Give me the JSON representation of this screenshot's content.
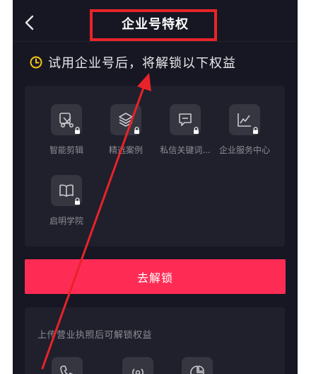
{
  "header": {
    "title": "企业号特权"
  },
  "notice": {
    "text": "试用企业号后，将解锁以下权益"
  },
  "features": [
    {
      "label": "智能剪辑",
      "icon": "scissors-icon"
    },
    {
      "label": "精选案例",
      "icon": "layers-icon"
    },
    {
      "label": "私信关键词...",
      "icon": "chat-icon"
    },
    {
      "label": "企业服务中心",
      "icon": "chart-icon"
    },
    {
      "label": "启明学院",
      "icon": "book-icon"
    }
  ],
  "unlock_button": {
    "label": "去解锁"
  },
  "license_section": {
    "title": "上传营业执照后可解锁权益",
    "icons": [
      "phone-icon",
      "broadcast-icon",
      "pie-chart-icon"
    ]
  },
  "colors": {
    "background": "#161722",
    "card": "#1f202b",
    "accent": "#fe2c55",
    "clock": "#f5c518",
    "annotation": "#e8232a"
  }
}
